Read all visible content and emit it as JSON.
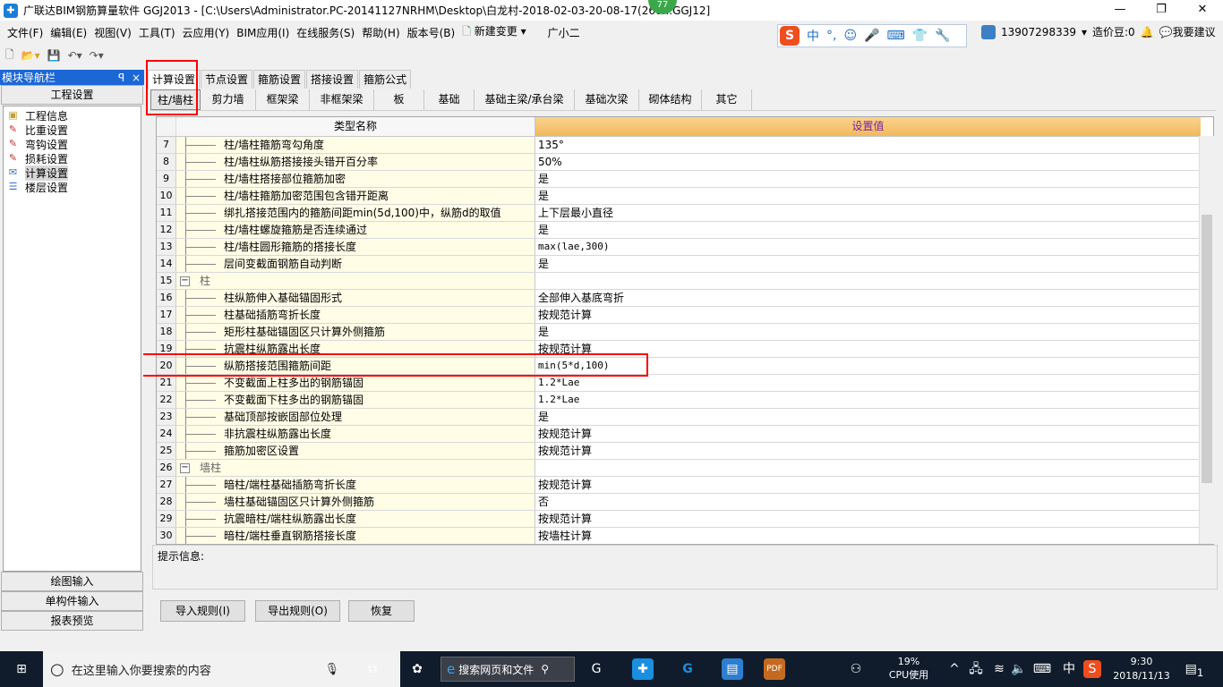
{
  "window": {
    "title": "广联达BIM钢筋算量软件 GGJ2013 - [C:\\Users\\Administrator.PC-20141127NRHM\\Desktop\\白龙村-2018-02-03-20-08-17(260...GGJ12]",
    "badge": "77",
    "minimize": "—",
    "restore": "❐",
    "close": "✕"
  },
  "menu": [
    "文件(F)",
    "编辑(E)",
    "视图(V)",
    "工具(T)",
    "云应用(Y)",
    "BIM应用(I)",
    "在线服务(S)",
    "帮助(H)",
    "版本号(B)",
    "新建变更",
    "▾",
    "广小二"
  ],
  "ime": {
    "logo": "S",
    "items": [
      "中",
      "°,",
      "☺",
      "🎤",
      "⌨",
      "👕",
      "🔧"
    ]
  },
  "user": {
    "phone": "13907298339",
    "dropdown": "▾",
    "beans": "造价豆:0",
    "feedback": "我要建议"
  },
  "nav": {
    "title": "模块导航栏",
    "pin": "ꟼ",
    "close": "×",
    "section": "工程设置",
    "items": [
      "工程信息",
      "比重设置",
      "弯钩设置",
      "损耗设置",
      "计算设置",
      "楼层设置"
    ],
    "selected": "计算设置",
    "bottom": [
      "绘图输入",
      "单构件输入",
      "报表预览"
    ]
  },
  "tabs": [
    "计算设置",
    "节点设置",
    "箍筋设置",
    "搭接设置",
    "箍筋公式"
  ],
  "subtabs": [
    "柱/墙柱",
    "剪力墙",
    "框架梁",
    "非框架梁",
    "板",
    "基础",
    "基础主梁/承台梁",
    "基础次梁",
    "砌体结构",
    "其它"
  ],
  "grid": {
    "col_name": "类型名称",
    "col_value": "设置值",
    "rows": [
      {
        "n": "7",
        "name": "柱/墙柱箍筋弯勾角度",
        "value": "135°"
      },
      {
        "n": "8",
        "name": "柱/墙柱纵筋搭接接头错开百分率",
        "value": "50%"
      },
      {
        "n": "9",
        "name": "柱/墙柱搭接部位箍筋加密",
        "value": "是"
      },
      {
        "n": "10",
        "name": "柱/墙柱箍筋加密范围包含错开距离",
        "value": "是"
      },
      {
        "n": "11",
        "name": "绑扎搭接范围内的箍筋间距min(5d,100)中，纵筋d的取值",
        "value": "上下层最小直径"
      },
      {
        "n": "12",
        "name": "柱/墙柱螺旋箍筋是否连续通过",
        "value": "是"
      },
      {
        "n": "13",
        "name": "柱/墙柱圆形箍筋的搭接长度",
        "value": "max(lae,300)"
      },
      {
        "n": "14",
        "name": "层间变截面钢筋自动判断",
        "value": "是"
      },
      {
        "n": "15",
        "name": "柱",
        "value": "",
        "group": true
      },
      {
        "n": "16",
        "name": "柱纵筋伸入基础锚固形式",
        "value": "全部伸入基底弯折"
      },
      {
        "n": "17",
        "name": "柱基础插筋弯折长度",
        "value": "按规范计算"
      },
      {
        "n": "18",
        "name": "矩形柱基础锚固区只计算外侧箍筋",
        "value": "是"
      },
      {
        "n": "19",
        "name": "抗震柱纵筋露出长度",
        "value": "按规范计算"
      },
      {
        "n": "20",
        "name": "纵筋搭接范围箍筋间距",
        "value": "min(5*d,100)"
      },
      {
        "n": "21",
        "name": "不变截面上柱多出的钢筋锚固",
        "value": "1.2*Lae"
      },
      {
        "n": "22",
        "name": "不变截面下柱多出的钢筋锚固",
        "value": "1.2*Lae"
      },
      {
        "n": "23",
        "name": "基础顶部按嵌固部位处理",
        "value": "是"
      },
      {
        "n": "24",
        "name": "非抗震柱纵筋露出长度",
        "value": "按规范计算"
      },
      {
        "n": "25",
        "name": "箍筋加密区设置",
        "value": "按规范计算"
      },
      {
        "n": "26",
        "name": "墙柱",
        "value": "",
        "group": true
      },
      {
        "n": "27",
        "name": "暗柱/端柱基础插筋弯折长度",
        "value": "按规范计算"
      },
      {
        "n": "28",
        "name": "墙柱基础锚固区只计算外侧箍筋",
        "value": "否"
      },
      {
        "n": "29",
        "name": "抗震暗柱/端柱纵筋露出长度",
        "value": "按规范计算"
      },
      {
        "n": "30",
        "name": "暗柱/端柱垂直钢筋搭接长度",
        "value": "按墙柱计算"
      }
    ]
  },
  "hint_label": "提示信息:",
  "buttons": {
    "import": "导入规则(I)",
    "export": "导出规则(O)",
    "restore": "恢复"
  },
  "taskbar": {
    "search_placeholder": "在这里输入你要搜索的内容",
    "browser_search": "搜索网页和文件",
    "cpu_pct": "19%",
    "cpu_label": "CPU使用",
    "ime": "中",
    "time": "9:30",
    "date": "2018/11/13",
    "notifications": "1"
  },
  "colors": {
    "nav_header": "#1b67d6",
    "value_header": "#f0b95c",
    "highlight": "#ff0000",
    "taskbar": "#101c2c"
  }
}
